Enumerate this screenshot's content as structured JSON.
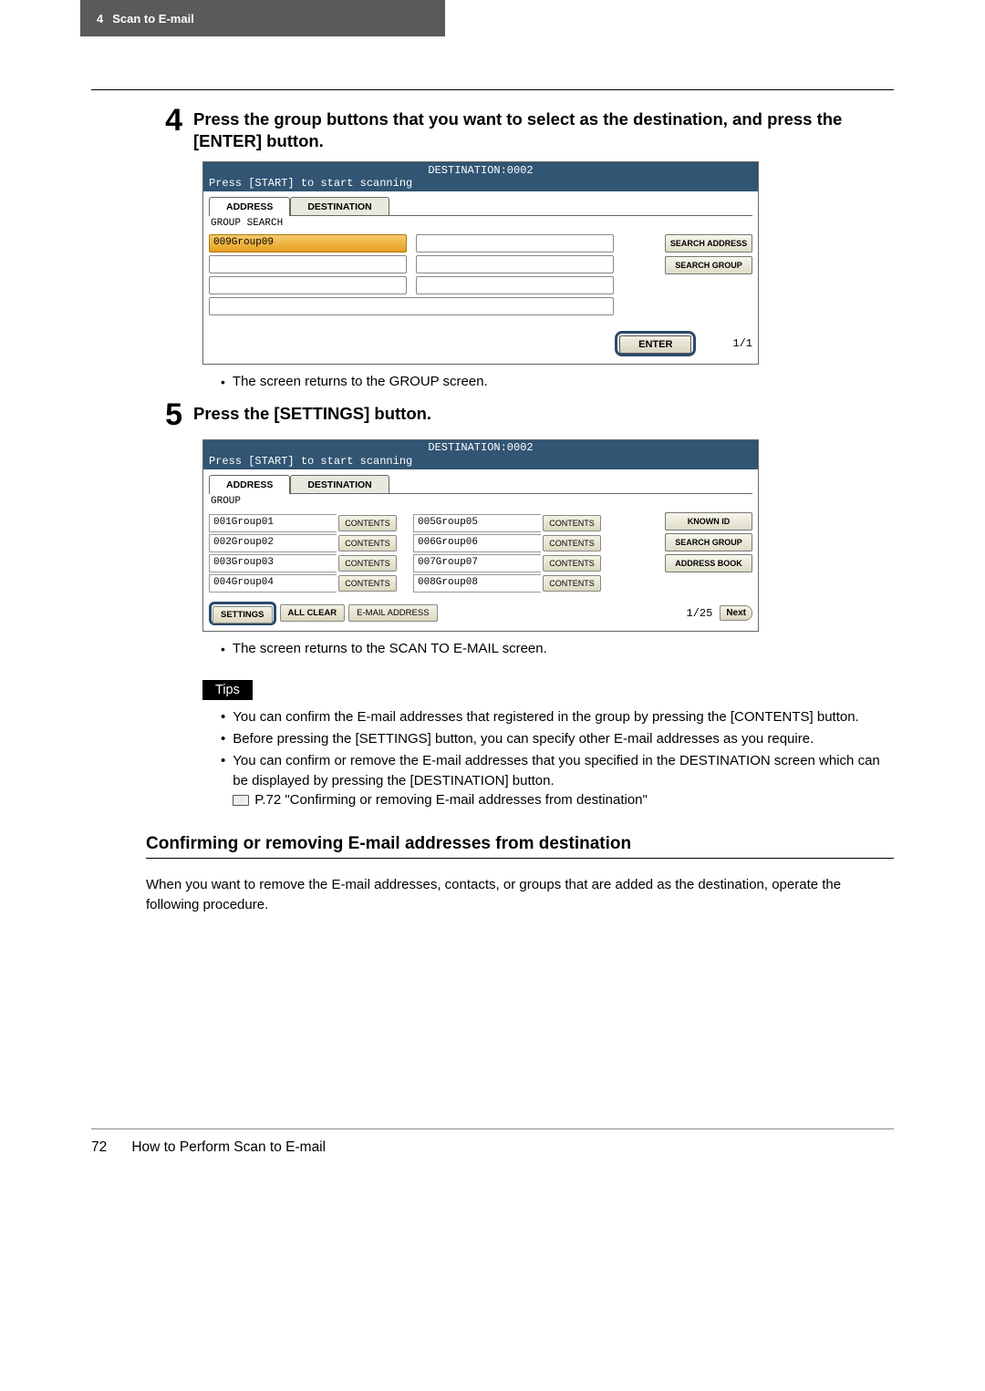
{
  "header": {
    "chapter_num": "4",
    "chapter_title": "Scan to E-mail"
  },
  "step4": {
    "num": "4",
    "title": "Press the group buttons that you want to select as the destination, and press the [ENTER] button."
  },
  "screen1": {
    "dest_line": "DESTINATION:0002",
    "prompt": "Press [START] to start scanning",
    "tab_address": "ADDRESS",
    "tab_destination": "DESTINATION",
    "crumb": "GROUP SEARCH",
    "selected_group": "009Group09",
    "side_search_address": "SEARCH ADDRESS",
    "side_search_group": "SEARCH GROUP",
    "enter": "ENTER",
    "page": "1/1"
  },
  "note1": "The screen returns to the GROUP screen.",
  "step5": {
    "num": "5",
    "title": "Press the [SETTINGS] button."
  },
  "screen2": {
    "dest_line": "DESTINATION:0002",
    "prompt": "Press [START] to start scanning",
    "tab_address": "ADDRESS",
    "tab_destination": "DESTINATION",
    "crumb": "GROUP",
    "contents_label": "CONTENTS",
    "groups_left": [
      "001Group01",
      "002Group02",
      "003Group03",
      "004Group04"
    ],
    "groups_right": [
      "005Group05",
      "006Group06",
      "007Group07",
      "008Group08"
    ],
    "side_known_id": "KNOWN ID",
    "side_search_group": "SEARCH GROUP",
    "side_address_book": "ADDRESS BOOK",
    "btn_settings": "SETTINGS",
    "btn_all_clear": "ALL CLEAR",
    "btn_email_address": "E-MAIL ADDRESS",
    "page": "1/25",
    "btn_next": "Next"
  },
  "note2": "The screen returns to the SCAN TO E-MAIL screen.",
  "tips_label": "Tips",
  "tips": [
    "You can confirm the E-mail addresses that registered in the group by pressing the [CONTENTS] button.",
    "Before pressing the [SETTINGS] button, you can specify other E-mail addresses as you require.",
    "You can confirm or remove the E-mail addresses that you specified in the DESTINATION screen which can be displayed by pressing the [DESTINATION] button."
  ],
  "tips_ref": "P.72 \"Confirming or removing E-mail addresses from destination\"",
  "subheading": "Confirming or removing E-mail addresses from destination",
  "sub_para": "When you want to remove the E-mail addresses, contacts, or groups that are added as the destination, operate the following procedure.",
  "footer": {
    "page_num": "72",
    "title": "How to Perform Scan to E-mail"
  }
}
